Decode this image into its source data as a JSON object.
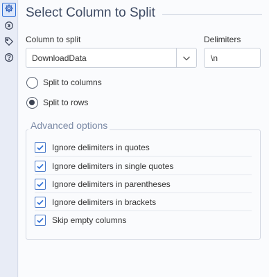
{
  "rail": {
    "items": [
      {
        "icon": "gear-icon",
        "active": true
      },
      {
        "icon": "nav-arrows-icon",
        "active": false
      },
      {
        "icon": "tag-icon",
        "active": false
      },
      {
        "icon": "help-icon",
        "active": false
      }
    ]
  },
  "header": {
    "title": "Select Column to Split"
  },
  "column_select": {
    "label": "Column to split",
    "value": "DownloadData"
  },
  "delimiters": {
    "label": "Delimiters",
    "value": "\\n"
  },
  "split_mode": {
    "options": [
      {
        "label": "Split to columns",
        "selected": false
      },
      {
        "label": "Split to rows",
        "selected": true
      }
    ]
  },
  "advanced": {
    "title": "Advanced options",
    "options": [
      {
        "label": "Ignore delimiters in quotes",
        "checked": true
      },
      {
        "label": "Ignore delimiters in single quotes",
        "checked": true
      },
      {
        "label": "Ignore delimiters in parentheses",
        "checked": true
      },
      {
        "label": "Ignore delimiters in brackets",
        "checked": true
      },
      {
        "label": "Skip empty columns",
        "checked": true
      }
    ]
  },
  "colors": {
    "accent": "#2f6fd6",
    "check": "#2f6fd6",
    "legend": "#7b8aa6"
  }
}
